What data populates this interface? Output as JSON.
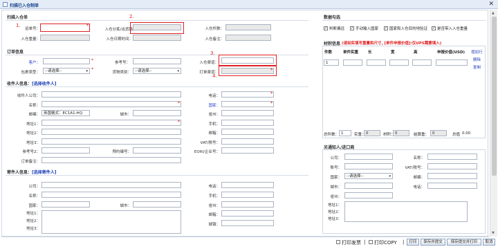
{
  "window": {
    "title": "扫描已入仓制单",
    "close": "✕"
  },
  "scan_section": {
    "title": "扫描入仓单",
    "fields": {
      "tracking_no": "运单号：",
      "warehouse_route": "入仓分拣/出货路",
      "warehouse_count": "入仓件数：",
      "warehouse_weight": "入仓重量：",
      "warehouse_time": "入仓日期时间：",
      "warehouse_remark": "入仓备注："
    }
  },
  "order_section": {
    "title": "订单信息",
    "customer": "客户：",
    "reference": "参考号：",
    "warehouse_channel": "入仓渠道：",
    "package_type": "包裹类型：",
    "package_type_value": "--请选择--",
    "goods_type": "货物类别：",
    "goods_type_value": "--请选择--",
    "print_channel": "打单渠道："
  },
  "recipient_section": {
    "title": "收件人信息：",
    "select_link": "[选择收件人]",
    "company": "收件人公司：",
    "name": "名称：",
    "postcode": "邮编：",
    "postcode_value": "英国格式：EC1A1-HQ",
    "city": "城市：",
    "address1": "地址1：",
    "address2": "地址2：",
    "address3": "地址3：",
    "reference2": "参考号2：",
    "booking_no": "预约编号：",
    "order_remark": "订单备注：",
    "phone": "电话：",
    "country": "国家：",
    "province": "省州：",
    "mobile": "手机：",
    "email": "邮箱：",
    "vat": "VAT/税号：",
    "eori": "EORI/企业号："
  },
  "sender_section": {
    "title": "寄件人信息：",
    "select_link": "[选择寄件人]",
    "company": "公司：",
    "name": "名称：",
    "country": "国家：",
    "city": "城市：",
    "address1": "地址1：",
    "address2": "地址2：",
    "address3": "地址3：",
    "phone": "电话：",
    "mobile": "手机：",
    "province": "省州：",
    "email": "邮箱：",
    "town": "城镇："
  },
  "data_options": {
    "title": "数据勾选",
    "options": [
      "判断偏远",
      "手动输入国家",
      "国家和入仓目的地验证",
      "是否带入入仓重量"
    ]
  },
  "material": {
    "title": "材积信息",
    "note": "(请如实填写重量和尺寸, [单件申报价值]:仅UPS需要填入)",
    "headers": [
      "件数",
      "单件实重",
      "长",
      "宽",
      "高",
      "申报价值(USD)"
    ],
    "row_qty": "1",
    "add_row": "增加行",
    "delete": "删除",
    "copy": "复制",
    "totals": {
      "total_count_label": "总件数：",
      "total_count": "1",
      "actual_weight_label": "实重：",
      "actual_weight": "0",
      "volume_label": "材积：",
      "volume": "0",
      "bill_weight_label": "结算重：",
      "bill_weight": "0",
      "total_value_label": "总值",
      "total_value": "0.00"
    }
  },
  "notify": {
    "title": "另通知人/进口商",
    "company": "公司：",
    "name": "名称：",
    "account": "账号：",
    "vat": "VAT/税号：",
    "country": "国家：",
    "country_value": "--请选择--",
    "postcode": "邮编：",
    "city": "城市：",
    "phone": "电话：",
    "province": "省州：",
    "address1": "地址1：",
    "address2": "地址2：",
    "address3": "地址3："
  },
  "annotations": [
    "1.",
    "2.",
    "3.",
    "4."
  ],
  "footer": {
    "print_invoice": "打印发票",
    "print_copy": "打印COPY",
    "sep": "|",
    "print": "打印",
    "save_submit": "保存并提交",
    "save_submit_print": "保存提交并打印",
    "cancel": "取消"
  }
}
